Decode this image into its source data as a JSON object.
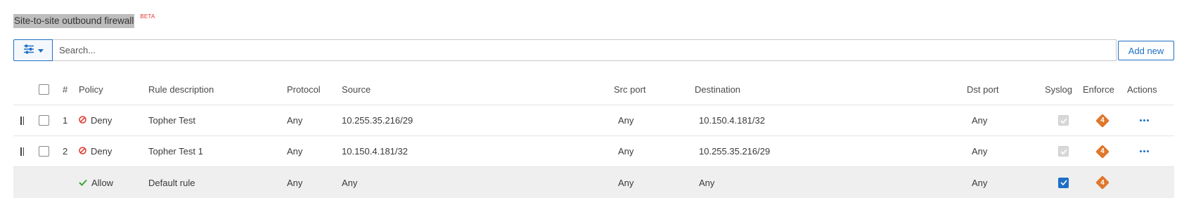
{
  "page": {
    "title": "Site-to-site outbound firewall",
    "badge": "BETA"
  },
  "toolbar": {
    "search_placeholder": "Search...",
    "add_label": "Add new"
  },
  "table": {
    "headers": {
      "num": "#",
      "policy": "Policy",
      "description": "Rule description",
      "protocol": "Protocol",
      "source": "Source",
      "src_port": "Src port",
      "destination": "Destination",
      "dst_port": "Dst port",
      "syslog": "Syslog",
      "enforce": "Enforce",
      "actions": "Actions"
    },
    "rows": [
      {
        "num": "1",
        "policy": "Deny",
        "description": "Topher Test",
        "protocol": "Any",
        "source": "10.255.35.216/29",
        "src_port": "Any",
        "destination": "10.150.4.181/32",
        "dst_port": "Any",
        "enforce": "4"
      },
      {
        "num": "2",
        "policy": "Deny",
        "description": "Topher Test 1",
        "protocol": "Any",
        "source": "10.150.4.181/32",
        "src_port": "Any",
        "destination": "10.255.35.216/29",
        "dst_port": "Any",
        "enforce": "4"
      },
      {
        "num": "",
        "policy": "Allow",
        "description": "Default rule",
        "protocol": "Any",
        "source": "Any",
        "src_port": "Any",
        "destination": "Any",
        "dst_port": "Any",
        "enforce": "4"
      }
    ]
  },
  "icons": {
    "filter": "sliders-icon",
    "deny": "ban-icon",
    "allow": "check-icon",
    "enforce": "diamond-badge-icon",
    "actions": "ellipsis-icon",
    "drag": "drag-handle-icon"
  },
  "colors": {
    "accent": "#1e6fc5",
    "deny": "#e0362b",
    "allow": "#3aa53a",
    "enforce": "#e0772b",
    "title_highlight": "#bdbdbd"
  }
}
